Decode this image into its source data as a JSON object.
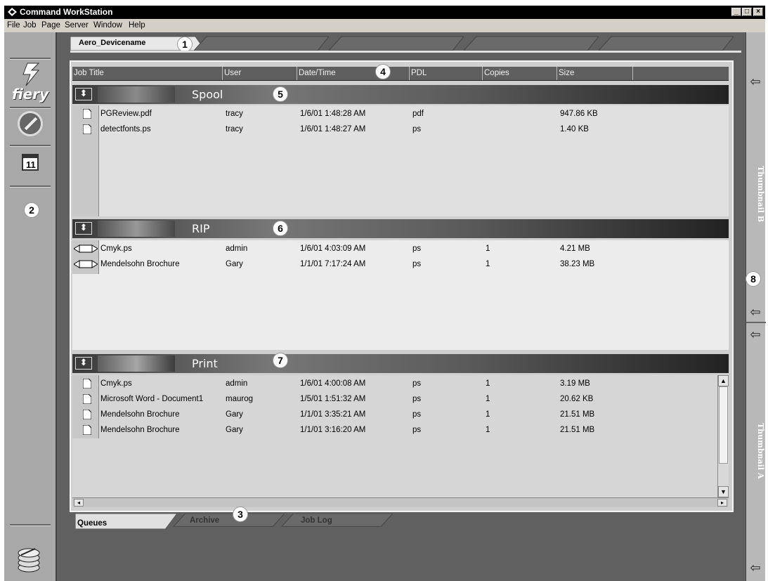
{
  "window": {
    "title": "Command WorkStation",
    "buttons": [
      "_",
      "□",
      "×"
    ]
  },
  "menu": [
    "File",
    "Job",
    "Page",
    "Server",
    "Window",
    "Help"
  ],
  "server_tab": {
    "label": "Aero_Devicename"
  },
  "left_panel": {
    "logo_text": "fiery"
  },
  "columns": [
    "Job Title",
    "User",
    "Date/Time",
    "PDL",
    "Copies",
    "Size"
  ],
  "queues": {
    "spool": {
      "title": "Spool",
      "rows": [
        {
          "title": "PGReview.pdf",
          "user": "tracy",
          "datetime": "1/6/01  1:48:28 AM",
          "pdl": "pdf",
          "copies": "",
          "size": "947.86 KB"
        },
        {
          "title": "detectfonts.ps",
          "user": "tracy",
          "datetime": "1/6/01  1:48:27 AM",
          "pdl": "ps",
          "copies": "",
          "size": "1.40 KB"
        }
      ]
    },
    "rip": {
      "title": "RIP",
      "rows": [
        {
          "title": "Cmyk.ps",
          "user": "admin",
          "datetime": "1/6/01  4:03:09 AM",
          "pdl": "ps",
          "copies": "1",
          "size": "4.21 MB"
        },
        {
          "title": "Mendelsohn Brochure",
          "user": "Gary",
          "datetime": "1/1/01  7:17:24 AM",
          "pdl": "ps",
          "copies": "1",
          "size": "38.23 MB"
        }
      ]
    },
    "print": {
      "title": "Print",
      "rows": [
        {
          "title": "Cmyk.ps",
          "user": "admin",
          "datetime": "1/6/01  4:00:08 AM",
          "pdl": "ps",
          "copies": "1",
          "size": "3.19 MB"
        },
        {
          "title": "Microsoft Word - Document1",
          "user": "maurog",
          "datetime": "1/5/01  1:51:32 AM",
          "pdl": "ps",
          "copies": "1",
          "size": "20.62 KB"
        },
        {
          "title": "Mendelsohn Brochure",
          "user": "Gary",
          "datetime": "1/1/01  3:35:21 AM",
          "pdl": "ps",
          "copies": "1",
          "size": "21.51 MB"
        },
        {
          "title": "Mendelsohn Brochure",
          "user": "Gary",
          "datetime": "1/1/01  3:16:20 AM",
          "pdl": "ps",
          "copies": "1",
          "size": "21.51 MB"
        }
      ]
    }
  },
  "bottom_tabs": [
    "Queues",
    "Archive",
    "Job Log"
  ],
  "right_panel": {
    "thumbnail_b": "Thumbnail B",
    "thumbnail_a": "Thumbnail A"
  },
  "callouts": [
    "1",
    "2",
    "3",
    "4",
    "5",
    "6",
    "7",
    "8"
  ]
}
